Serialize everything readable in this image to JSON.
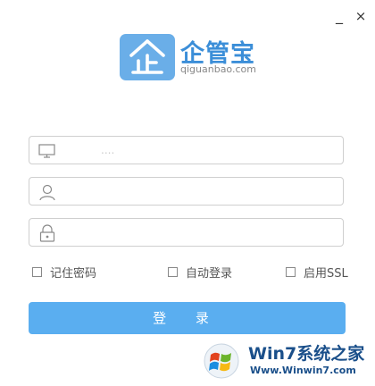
{
  "window": {
    "minimize_label": "_",
    "close_label": "×"
  },
  "logo": {
    "title": "企管宝",
    "domain": "qiguanbao.com",
    "icon": "qi-logo-icon",
    "color": "#6aaee8"
  },
  "fields": {
    "server": {
      "icon": "monitor-icon",
      "placeholder": "....",
      "value": ""
    },
    "username": {
      "icon": "user-icon",
      "placeholder": "",
      "value": ""
    },
    "password": {
      "icon": "lock-icon",
      "placeholder": "",
      "value": ""
    }
  },
  "options": {
    "remember_password": {
      "label": "记住密码",
      "checked": false
    },
    "auto_login": {
      "label": "自动登录",
      "checked": false
    },
    "enable_ssl": {
      "label": "启用SSL",
      "checked": false
    }
  },
  "login_button": {
    "label": "登 录",
    "color": "#5aaef0"
  },
  "watermark": {
    "title": "Win7系统之家",
    "url": "Www.Winwin7.com",
    "icon": "windows-logo-icon"
  }
}
